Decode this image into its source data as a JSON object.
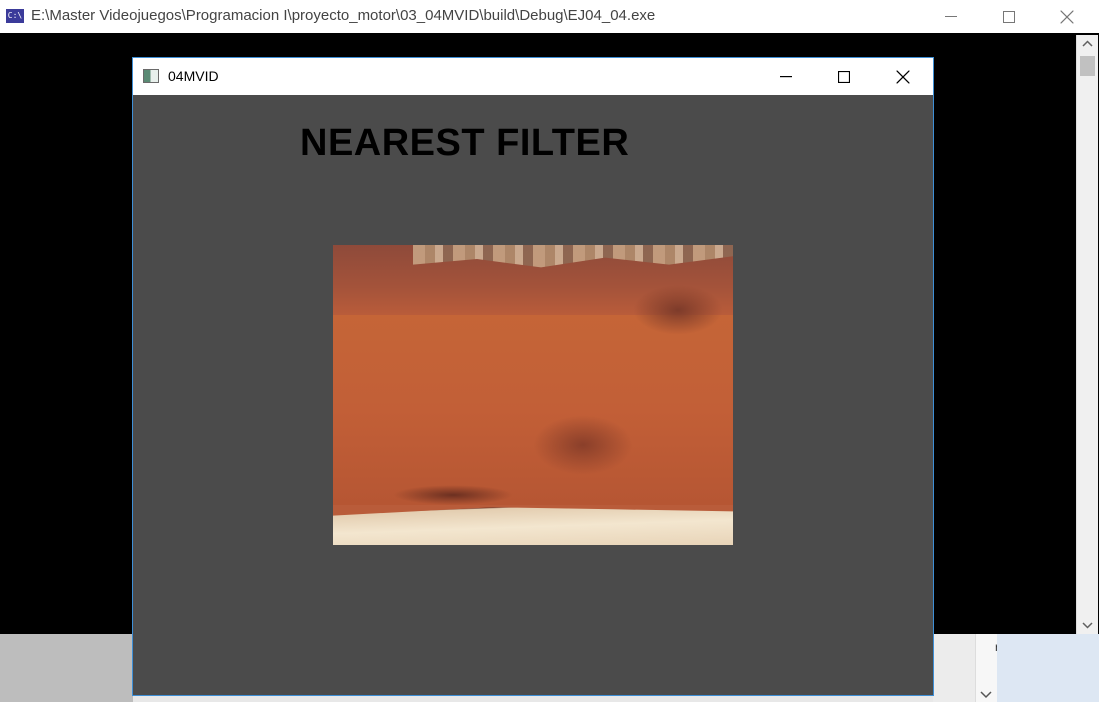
{
  "console_window": {
    "icon_text": "C:\\",
    "title": "E:\\Master Videojuegos\\Programacion I\\proyecto_motor\\03_04MVID\\build\\Debug\\EJ04_04.exe",
    "background_color": "#000000"
  },
  "gl_window": {
    "title": "04MVID",
    "canvas_color": "#4b4b4b",
    "label": "NEAREST FILTER",
    "texture_description_icon": "brick-texture"
  },
  "background": {
    "pane_letter": "r"
  }
}
